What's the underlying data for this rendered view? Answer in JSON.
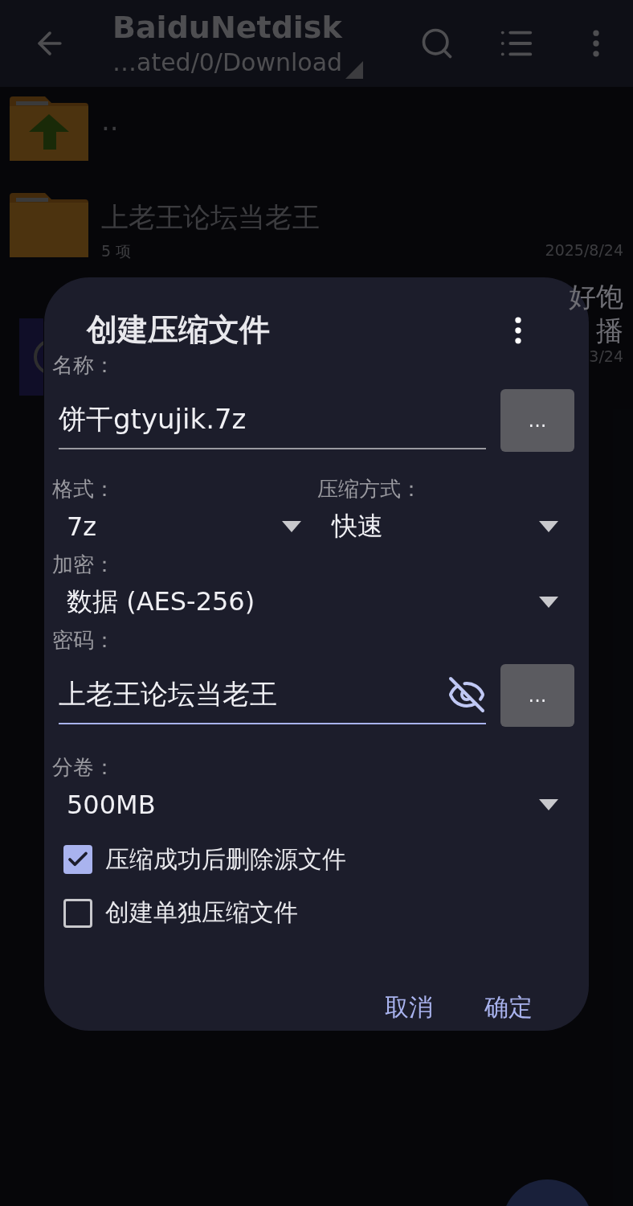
{
  "app_bar": {
    "title": "BaiduNetdisk",
    "path": "…ated/0/Download"
  },
  "files": [
    {
      "kind": "parent",
      "name": ".."
    },
    {
      "kind": "folder",
      "name": "上老王论坛当老王",
      "meta": "5 项",
      "date": "2025/8/24"
    },
    {
      "kind": "video",
      "name": "好饱",
      "name_line_2": "播",
      "date": "3/24"
    }
  ],
  "dialog": {
    "title": "创建压缩文件",
    "name": {
      "label": "名称：",
      "value": "饼干gtyujik.7z",
      "button": "..."
    },
    "format": {
      "label": "格式：",
      "value": "7z"
    },
    "method": {
      "label": "压缩方式：",
      "value": "快速"
    },
    "encryption": {
      "label": "加密：",
      "value": "数据 (AES-256)"
    },
    "password": {
      "label": "密码：",
      "value": "上老王论坛当老王",
      "visible": true,
      "button": "..."
    },
    "split": {
      "label": "分卷：",
      "value": "500MB"
    },
    "options": [
      {
        "label": "压缩成功后删除源文件",
        "checked": true
      },
      {
        "label": "创建单独压缩文件",
        "checked": false
      }
    ],
    "buttons": [
      "取消",
      "确定"
    ]
  }
}
